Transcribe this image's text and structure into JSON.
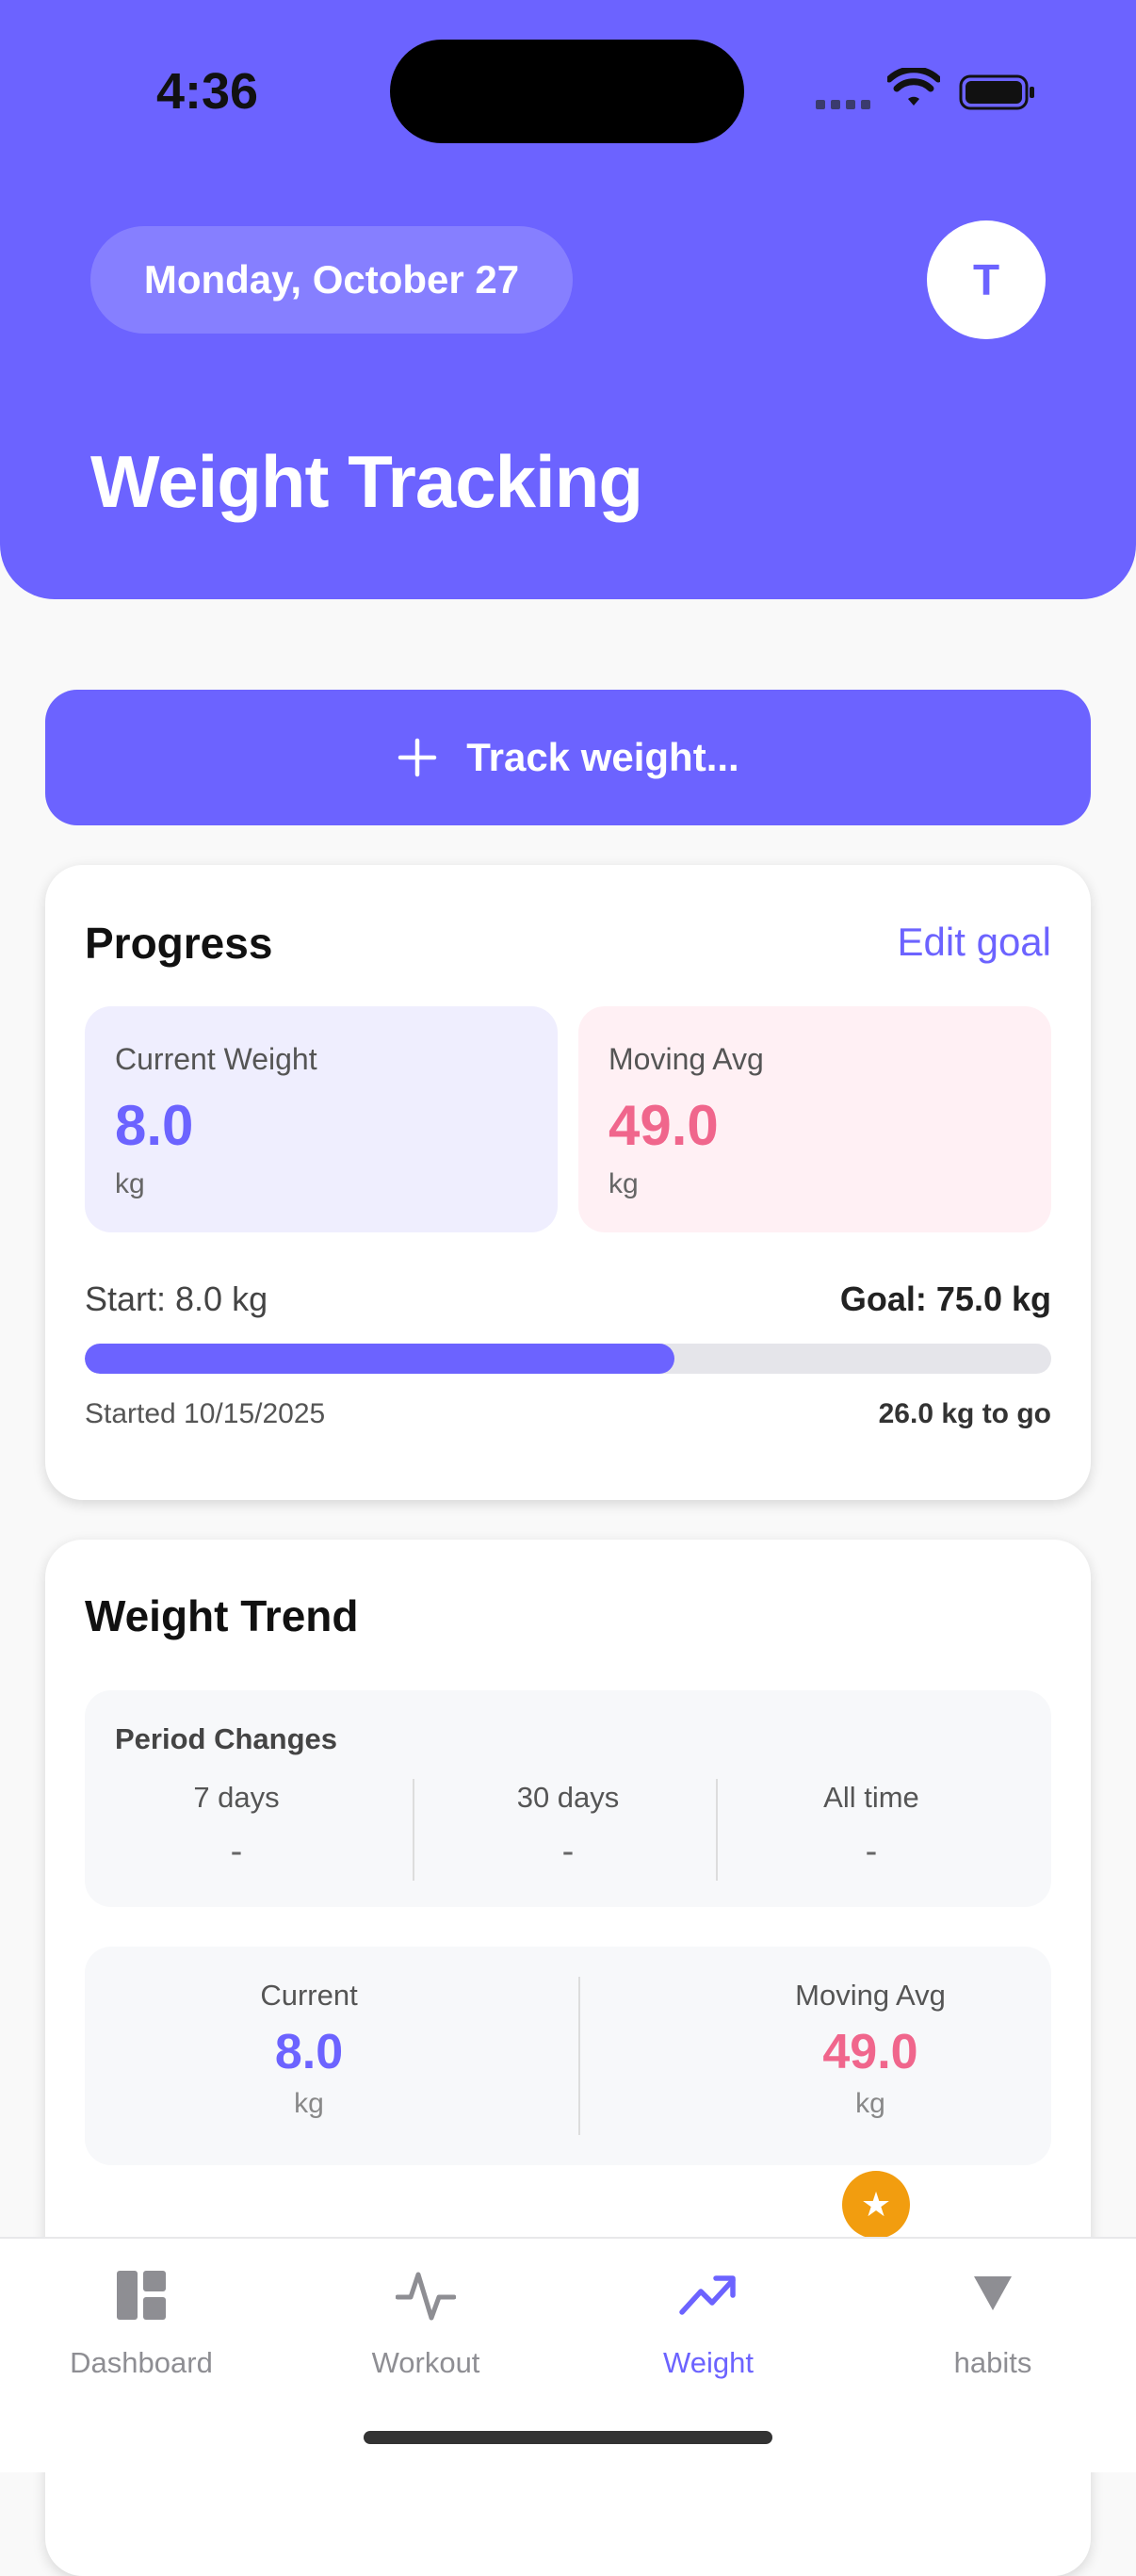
{
  "status_bar": {
    "time": "4:36"
  },
  "header": {
    "date": "Monday, October 27",
    "avatar_initial": "T",
    "title": "Weight Tracking",
    "color": "#6c63ff"
  },
  "track_button": {
    "label": "Track weight...",
    "icon": "plus-icon"
  },
  "progress": {
    "title": "Progress",
    "edit_goal": "Edit goal",
    "current": {
      "label": "Current Weight",
      "value": "8.0",
      "unit": "kg"
    },
    "moving_avg": {
      "label": "Moving Avg",
      "value": "49.0",
      "unit": "kg"
    },
    "start": "Start: 8.0 kg",
    "goal": "Goal: 75.0 kg",
    "progress_fraction": 0.61,
    "started": "Started 10/15/2025",
    "to_go": "26.0 kg to go"
  },
  "trend": {
    "title": "Weight Trend",
    "period_title": "Period Changes",
    "periods": [
      {
        "label": "7 days",
        "value": "-"
      },
      {
        "label": "30 days",
        "value": "-"
      },
      {
        "label": "All time",
        "value": "-"
      }
    ],
    "current": {
      "label": "Current",
      "value": "8.0",
      "unit": "kg"
    },
    "moving_avg": {
      "label": "Moving Avg",
      "value": "49.0",
      "unit": "kg"
    }
  },
  "tabs": [
    {
      "label": "Dashboard",
      "icon": "dashboard-icon",
      "active": false
    },
    {
      "label": "Workout",
      "icon": "pulse-icon",
      "active": false
    },
    {
      "label": "Weight",
      "icon": "trending-up-icon",
      "active": true
    },
    {
      "label": "habits",
      "icon": "triangle-down-icon",
      "active": false
    }
  ],
  "colors": {
    "accent": "#6c63ff",
    "pink": "#f0668c",
    "star": "#f29d0f"
  }
}
